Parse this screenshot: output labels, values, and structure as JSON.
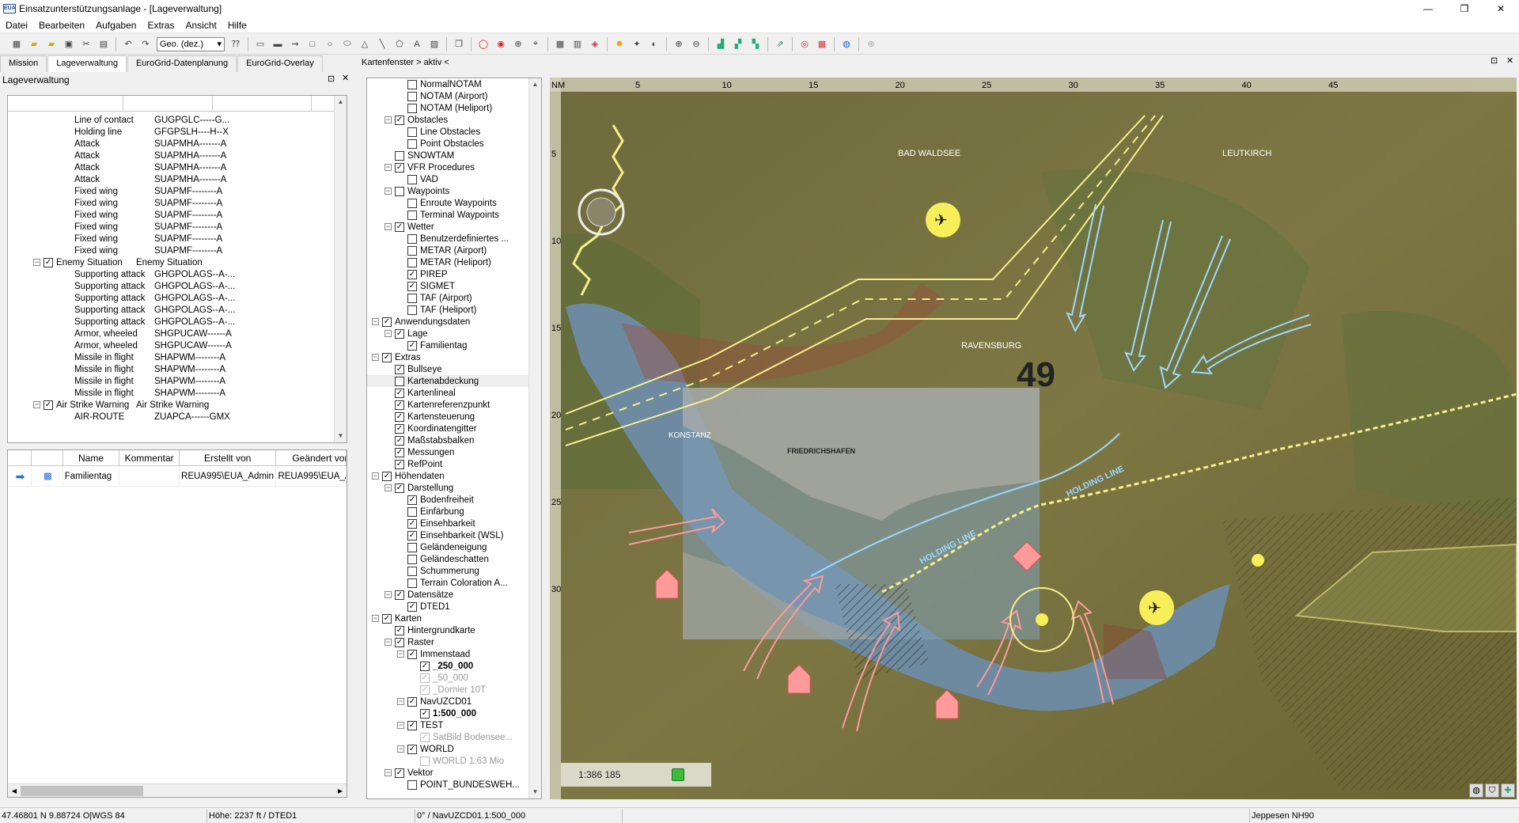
{
  "window": {
    "title": "Einsatzunterstützungsanlage - [Lageverwaltung]",
    "app_abbr": "EUA",
    "minimize": "—",
    "maximize": "❐",
    "close": "✕"
  },
  "menu": [
    "Datei",
    "Bearbeiten",
    "Aufgaben",
    "Extras",
    "Ansicht",
    "Hilfe"
  ],
  "toolbar": {
    "coord_mode": "Geo. (dez.)"
  },
  "tabs": [
    "Mission",
    "Lageverwaltung",
    "EuroGrid-Datenplanung",
    "EuroGrid-Overlay"
  ],
  "left_panel": {
    "title": "Lageverwaltung",
    "tree_rows": [
      {
        "name": "Line of contact",
        "code": "GUGPGLC-----G...",
        "indent": 84
      },
      {
        "name": "Holding line",
        "code": "GFGPSLH----H--X",
        "indent": 84
      },
      {
        "name": "Attack",
        "code": "SUAPMHA-------A",
        "indent": 84
      },
      {
        "name": "Attack",
        "code": "SUAPMHA-------A",
        "indent": 84
      },
      {
        "name": "Attack",
        "code": "SUAPMHA-------A",
        "indent": 84
      },
      {
        "name": "Attack",
        "code": "SUAPMHA-------A",
        "indent": 84
      },
      {
        "name": "Fixed wing",
        "code": "SUAPMF--------A",
        "indent": 84
      },
      {
        "name": "Fixed wing",
        "code": "SUAPMF--------A",
        "indent": 84
      },
      {
        "name": "Fixed wing",
        "code": "SUAPMF--------A",
        "indent": 84
      },
      {
        "name": "Fixed wing",
        "code": "SUAPMF--------A",
        "indent": 84
      },
      {
        "name": "Fixed wing",
        "code": "SUAPMF--------A",
        "indent": 84
      },
      {
        "name": "Fixed wing",
        "code": "SUAPMF--------A",
        "indent": 84
      },
      {
        "name": "Enemy Situation",
        "code": "Enemy Situation",
        "indent": 45,
        "expander": "−",
        "check": true
      },
      {
        "name": "Supporting attack",
        "code": "GHGPOLAGS--A-...",
        "indent": 84
      },
      {
        "name": "Supporting attack",
        "code": "GHGPOLAGS--A-...",
        "indent": 84
      },
      {
        "name": "Supporting attack",
        "code": "GHGPOLAGS--A-...",
        "indent": 84
      },
      {
        "name": "Supporting attack",
        "code": "GHGPOLAGS--A-...",
        "indent": 84
      },
      {
        "name": "Supporting attack",
        "code": "GHGPOLAGS--A-...",
        "indent": 84
      },
      {
        "name": "Armor, wheeled",
        "code": "SHGPUCAW------A",
        "indent": 84
      },
      {
        "name": "Armor, wheeled",
        "code": "SHGPUCAW------A",
        "indent": 84
      },
      {
        "name": "Missile in flight",
        "code": "SHAPWM--------A",
        "indent": 84
      },
      {
        "name": "Missile in flight",
        "code": "SHAPWM--------A",
        "indent": 84
      },
      {
        "name": "Missile in flight",
        "code": "SHAPWM--------A",
        "indent": 84
      },
      {
        "name": "Missile in flight",
        "code": "SHAPWM--------A",
        "indent": 84
      },
      {
        "name": "Air Strike Warning",
        "code": "Air Strike Warning",
        "indent": 45,
        "expander": "−",
        "check": true
      },
      {
        "name": "AIR-ROUTE",
        "code": "ZUAPCA------GMX",
        "indent": 84
      }
    ],
    "grid_headers": [
      "",
      "",
      "Name",
      "Kommentar",
      "Erstellt von",
      "Geändert von"
    ],
    "grid_rows": [
      {
        "name": "Familientag",
        "kommentar": "",
        "erstellt": "REUA995\\EUA_Admin",
        "geaendert": "REUA995\\EUA_Admin"
      }
    ]
  },
  "map_panel": {
    "title": "Kartenfenster > aktiv <"
  },
  "layers": [
    {
      "t": "NormalNOTAM",
      "l": 3,
      "c": 0
    },
    {
      "t": "NOTAM (Airport)",
      "l": 3,
      "c": 0
    },
    {
      "t": "NOTAM (Heliport)",
      "l": 3,
      "c": 0
    },
    {
      "t": "Obstacles",
      "l": 2,
      "c": 1,
      "e": 1
    },
    {
      "t": "Line Obstacles",
      "l": 3,
      "c": 0
    },
    {
      "t": "Point Obstacles",
      "l": 3,
      "c": 0
    },
    {
      "t": "SNOWTAM",
      "l": 2,
      "c": 0
    },
    {
      "t": "VFR Procedures",
      "l": 2,
      "c": 1,
      "e": 1
    },
    {
      "t": "VAD",
      "l": 3,
      "c": 0
    },
    {
      "t": "Waypoints",
      "l": 2,
      "c": 0,
      "e": 1
    },
    {
      "t": "Enroute Waypoints",
      "l": 3,
      "c": 0
    },
    {
      "t": "Terminal Waypoints",
      "l": 3,
      "c": 0
    },
    {
      "t": "Wetter",
      "l": 2,
      "c": 1,
      "e": 1
    },
    {
      "t": "Benutzerdefiniertes ...",
      "l": 3,
      "c": 0
    },
    {
      "t": "METAR (Airport)",
      "l": 3,
      "c": 0
    },
    {
      "t": "METAR (Heliport)",
      "l": 3,
      "c": 0
    },
    {
      "t": "PIREP",
      "l": 3,
      "c": 1
    },
    {
      "t": "SIGMET",
      "l": 3,
      "c": 1
    },
    {
      "t": "TAF (Airport)",
      "l": 3,
      "c": 0
    },
    {
      "t": "TAF (Heliport)",
      "l": 3,
      "c": 0
    },
    {
      "t": "Anwendungsdaten",
      "l": 1,
      "c": 1,
      "e": 1
    },
    {
      "t": "Lage",
      "l": 2,
      "c": 1,
      "e": 1
    },
    {
      "t": "Familientag",
      "l": 3,
      "c": 1
    },
    {
      "t": "Extras",
      "l": 1,
      "c": 1,
      "e": 1
    },
    {
      "t": "Bullseye",
      "l": 2,
      "c": 1
    },
    {
      "t": "Kartenabdeckung",
      "l": 2,
      "c": 0,
      "sel": 1
    },
    {
      "t": "Kartenlineal",
      "l": 2,
      "c": 1
    },
    {
      "t": "Kartenreferenzpunkt",
      "l": 2,
      "c": 1
    },
    {
      "t": "Kartensteuerung",
      "l": 2,
      "c": 1
    },
    {
      "t": "Koordinatengitter",
      "l": 2,
      "c": 1
    },
    {
      "t": "Maßstabsbalken",
      "l": 2,
      "c": 1
    },
    {
      "t": "Messungen",
      "l": 2,
      "c": 1
    },
    {
      "t": "RefPoint",
      "l": 2,
      "c": 1
    },
    {
      "t": "Höhendaten",
      "l": 1,
      "c": 1,
      "e": 1
    },
    {
      "t": "Darstellung",
      "l": 2,
      "c": 1,
      "e": 1
    },
    {
      "t": "Bodenfreiheit",
      "l": 3,
      "c": 1
    },
    {
      "t": "Einfärbung",
      "l": 3,
      "c": 0
    },
    {
      "t": "Einsehbarkeit",
      "l": 3,
      "c": 1
    },
    {
      "t": "Einsehbarkeit (WSL)",
      "l": 3,
      "c": 1
    },
    {
      "t": "Geländeneigung",
      "l": 3,
      "c": 0
    },
    {
      "t": "Geländeschatten",
      "l": 3,
      "c": 0
    },
    {
      "t": "Schummerung",
      "l": 3,
      "c": 0
    },
    {
      "t": "Terrain Coloration A...",
      "l": 3,
      "c": 0
    },
    {
      "t": "Datensätze",
      "l": 2,
      "c": 1,
      "e": 1
    },
    {
      "t": "DTED1",
      "l": 3,
      "c": 1
    },
    {
      "t": "Karten",
      "l": 1,
      "c": 1,
      "e": 1
    },
    {
      "t": "Hintergrundkarte",
      "l": 2,
      "c": 1
    },
    {
      "t": "Raster",
      "l": 2,
      "c": 1,
      "e": 1
    },
    {
      "t": "Immenstaad",
      "l": 3,
      "c": 1,
      "e": 1
    },
    {
      "t": "_250_000",
      "l": 4,
      "c": 1,
      "b": 1
    },
    {
      "t": "_50_000",
      "l": 4,
      "c": 2,
      "g": 1
    },
    {
      "t": "_Dornier 10T",
      "l": 4,
      "c": 2,
      "g": 1
    },
    {
      "t": "NavUZCD01",
      "l": 3,
      "c": 1,
      "e": 1
    },
    {
      "t": "1:500_000",
      "l": 4,
      "c": 1,
      "b": 1
    },
    {
      "t": "TEST",
      "l": 3,
      "c": 1,
      "e": 1
    },
    {
      "t": "SatBild Bodensee...",
      "l": 4,
      "c": 2,
      "g": 1
    },
    {
      "t": "WORLD",
      "l": 3,
      "c": 1,
      "e": 1
    },
    {
      "t": "WORLD 1:63 Mio",
      "l": 4,
      "c": 3,
      "g": 1
    },
    {
      "t": "Vektor",
      "l": 2,
      "c": 1,
      "e": 1
    },
    {
      "t": "POINT_BUNDESWEH...",
      "l": 3,
      "c": 0
    }
  ],
  "map": {
    "nm_label": "NM",
    "top_ticks": [
      "5",
      "10",
      "15",
      "20",
      "25",
      "30",
      "35",
      "40",
      "45"
    ],
    "left_ticks": [
      "5",
      "10",
      "15",
      "20",
      "25",
      "30"
    ],
    "scale": "1:386 185",
    "labels": [
      "49",
      "HOLDING LINE",
      "HOLDING LINE",
      "FRIEDRICHSHAFEN",
      "KONSTANZ",
      "RAVENSBURG",
      "BAD WALDSEE",
      "LEUTKIRCH"
    ],
    "colors": {
      "route": "#f6f08a",
      "holding": "#9ad7ff",
      "arrow_red": "#ff9a9a",
      "arrow_blue": "#9fd8ff",
      "symbol_yellow": "#f7ef5a"
    }
  },
  "status": {
    "coords": "47.46801 N 9.88724 O|WGS 84",
    "height": "Höhe: 2237 ft / DTED1",
    "map": "0° / NavUZCD01.1:500_000",
    "empty": "",
    "chart": "Jeppesen NH90"
  }
}
